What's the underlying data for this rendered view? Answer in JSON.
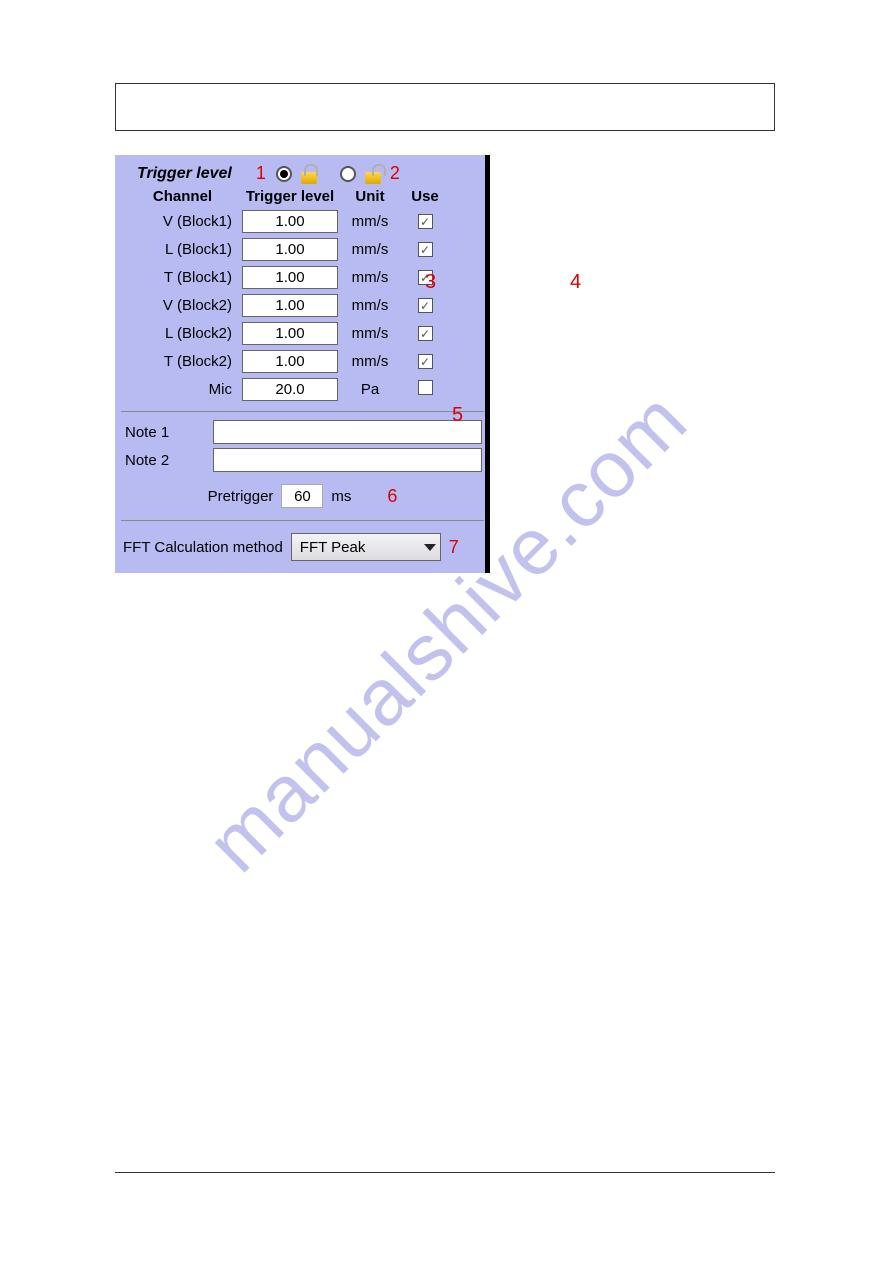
{
  "title": "Trigger level",
  "headers": {
    "channel": "Channel",
    "trigger": "Trigger level",
    "unit": "Unit",
    "use": "Use"
  },
  "annotations": {
    "n1": "1",
    "n2": "2",
    "n3": "3",
    "n4": "4",
    "n5": "5",
    "n6": "6",
    "n7": "7"
  },
  "channels": [
    {
      "label": "V (Block1)",
      "value": "1.00",
      "unit": "mm/s",
      "use": true
    },
    {
      "label": "L (Block1)",
      "value": "1.00",
      "unit": "mm/s",
      "use": true
    },
    {
      "label": "T (Block1)",
      "value": "1.00",
      "unit": "mm/s",
      "use": true
    },
    {
      "label": "V (Block2)",
      "value": "1.00",
      "unit": "mm/s",
      "use": true
    },
    {
      "label": "L (Block2)",
      "value": "1.00",
      "unit": "mm/s",
      "use": true
    },
    {
      "label": "T (Block2)",
      "value": "1.00",
      "unit": "mm/s",
      "use": true
    },
    {
      "label": "Mic",
      "value": "20.0",
      "unit": "Pa",
      "use": false
    }
  ],
  "notes": {
    "note1_label": "Note 1",
    "note1_value": "",
    "note2_label": "Note 2",
    "note2_value": ""
  },
  "pretrigger": {
    "label": "Pretrigger",
    "value": "60",
    "unit": "ms"
  },
  "fft": {
    "label": "FFT Calculation method",
    "value": "FFT Peak"
  },
  "watermark": "manualshive.com"
}
